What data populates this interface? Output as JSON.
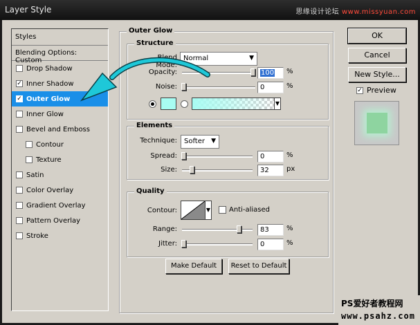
{
  "window": {
    "title": "Layer Style"
  },
  "watermark_top": {
    "text_left": "思缘设计论坛",
    "text_right": "www.missyuan.com"
  },
  "watermark_bottom": {
    "line1": "PS爱好者教程网",
    "line2": "www.psahz.com"
  },
  "styles_panel": {
    "header": "Styles",
    "blending": "Blending Options: Custom",
    "items": [
      {
        "label": "Drop Shadow",
        "checked": false,
        "indent": false,
        "selected": false
      },
      {
        "label": "Inner Shadow",
        "checked": true,
        "indent": false,
        "selected": false
      },
      {
        "label": "Outer Glow",
        "checked": true,
        "indent": false,
        "selected": true
      },
      {
        "label": "Inner Glow",
        "checked": false,
        "indent": false,
        "selected": false
      },
      {
        "label": "Bevel and Emboss",
        "checked": false,
        "indent": false,
        "selected": false
      },
      {
        "label": "Contour",
        "checked": false,
        "indent": true,
        "selected": false
      },
      {
        "label": "Texture",
        "checked": false,
        "indent": true,
        "selected": false
      },
      {
        "label": "Satin",
        "checked": false,
        "indent": false,
        "selected": false
      },
      {
        "label": "Color Overlay",
        "checked": false,
        "indent": false,
        "selected": false
      },
      {
        "label": "Gradient Overlay",
        "checked": false,
        "indent": false,
        "selected": false
      },
      {
        "label": "Pattern Overlay",
        "checked": false,
        "indent": false,
        "selected": false
      },
      {
        "label": "Stroke",
        "checked": false,
        "indent": false,
        "selected": false
      }
    ]
  },
  "outer_glow": {
    "title": "Outer Glow",
    "structure": {
      "title": "Structure",
      "blend_mode_label": "Blend Mode:",
      "blend_mode_value": "Normal",
      "opacity_label": "Opacity:",
      "opacity_value": "100",
      "opacity_unit": "%",
      "opacity_level": 1.0,
      "noise_label": "Noise:",
      "noise_value": "0",
      "noise_unit": "%",
      "noise_level": 0.0,
      "glow_color": "#a8fcf2"
    },
    "elements": {
      "title": "Elements",
      "technique_label": "Technique:",
      "technique_value": "Softer",
      "spread_label": "Spread:",
      "spread_value": "0",
      "spread_unit": "%",
      "spread_level": 0.0,
      "size_label": "Size:",
      "size_value": "32",
      "size_unit": "px",
      "size_level": 0.13
    },
    "quality": {
      "title": "Quality",
      "contour_label": "Contour:",
      "anti_aliased_label": "Anti-aliased",
      "anti_aliased": false,
      "range_label": "Range:",
      "range_value": "83",
      "range_unit": "%",
      "range_level": 0.83,
      "jitter_label": "Jitter:",
      "jitter_value": "0",
      "jitter_unit": "%",
      "jitter_level": 0.0
    },
    "make_default_label": "Make Default",
    "reset_default_label": "Reset to Default"
  },
  "buttons": {
    "ok": "OK",
    "cancel": "Cancel",
    "new_style": "New Style..."
  },
  "preview": {
    "label": "Preview",
    "checked": true
  },
  "colors": {
    "selection": "#1a8fe8",
    "arrow": "#1ec8d8"
  }
}
